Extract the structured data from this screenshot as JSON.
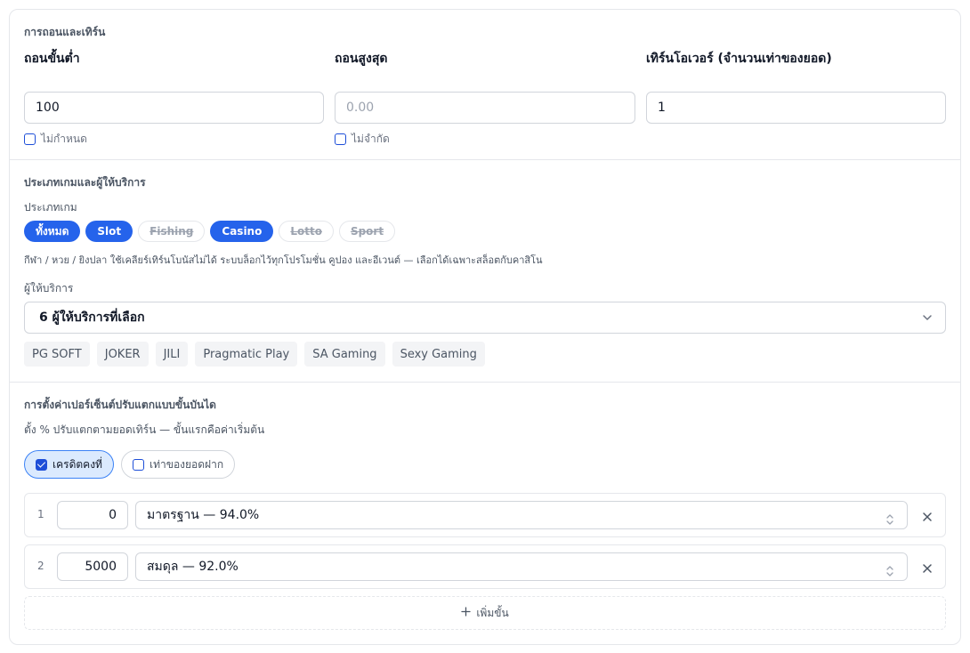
{
  "withdraw": {
    "section_title": "การถอนและเทิร์น",
    "min_label": "ถอนขั้นต่ำ",
    "max_label": "ถอนสูงสุด",
    "turnover_label": "เทิร์นโอเวอร์ (จำนวนเท่าของยอด)",
    "min_value": "100",
    "max_placeholder": "0.00",
    "max_value": "",
    "turnover_value": "1",
    "min_checkbox_label": "ไม่กำหนด",
    "max_checkbox_label": "ไม่จำกัด"
  },
  "games": {
    "section_title": "ประเภทเกมและผู้ให้บริการ",
    "type_label": "ประเภทเกม",
    "chips": [
      {
        "label": "ทั้งหมด",
        "state": "active"
      },
      {
        "label": "Slot",
        "state": "active"
      },
      {
        "label": "Fishing",
        "state": "disabled"
      },
      {
        "label": "Casino",
        "state": "active"
      },
      {
        "label": "Lotto",
        "state": "disabled"
      },
      {
        "label": "Sport",
        "state": "disabled"
      }
    ],
    "note": "กีฬา / หวย / ยิงปลา ใช้เคลียร์เทิร์นโบนัสไม่ได้ ระบบล็อกไว้ทุกโปรโมชั่น คูปอง และอีเวนต์ — เลือกได้เฉพาะสล็อตกับคาสิโน",
    "provider_label": "ผู้ให้บริการ",
    "provider_select": "6 ผู้ให้บริการที่เลือก",
    "providers": [
      "PG SOFT",
      "JOKER",
      "JILI",
      "Pragmatic Play",
      "SA Gaming",
      "Sexy Gaming"
    ]
  },
  "tiers": {
    "section_title": "การตั้งค่าเปอร์เซ็นต์ปรับแตกแบบขั้นบันได",
    "description": "ตั้ง % ปรับแตกตามยอดเทิร์น — ขั้นแรกคือค่าเริ่มต้น",
    "mode_fixed": "เครดิตคงที่",
    "mode_multiple": "เท่าของยอดฝาก",
    "mode_selected": "fixed",
    "rows": [
      {
        "index": "1",
        "amount": "0",
        "preset": "มาตรฐาน — 94.0%"
      },
      {
        "index": "2",
        "amount": "5000",
        "preset": "สมดุล — 92.0%"
      }
    ],
    "add_label": "เพิ่มขั้น"
  },
  "colors": {
    "accent": "#2563eb",
    "border": "#e5e7eb",
    "chip_disabled_text": "#9ca3af",
    "pill_selected_bg": "#dbeafe"
  }
}
